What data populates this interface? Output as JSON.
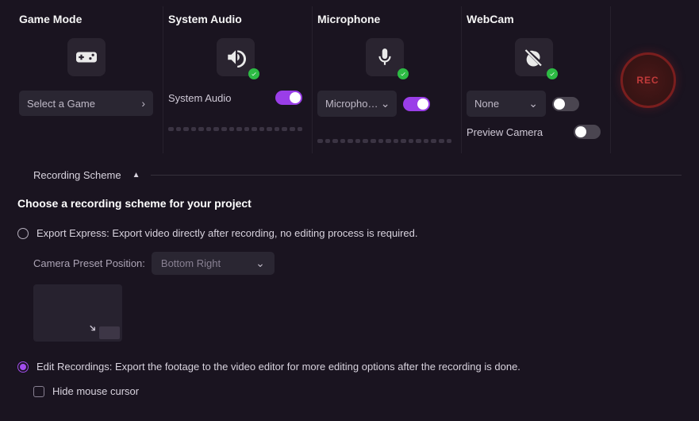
{
  "columns": {
    "gameMode": {
      "title": "Game Mode",
      "selectLabel": "Select a Game"
    },
    "systemAudio": {
      "title": "System Audio",
      "toggleLabel": "System Audio",
      "toggleOn": true
    },
    "microphone": {
      "title": "Microphone",
      "selectLabel": "Microphone A",
      "toggleOn": true
    },
    "webcam": {
      "title": "WebCam",
      "selectLabel": "None",
      "toggleOn": false,
      "previewLabel": "Preview Camera",
      "previewOn": false
    }
  },
  "recButton": "REC",
  "scheme": {
    "header": "Recording Scheme",
    "prompt": "Choose a recording scheme for your project",
    "optionExport": "Export Express: Export video directly after recording, no editing process is required.",
    "cameraPresetLabel": "Camera Preset Position:",
    "cameraPresetValue": "Bottom Right",
    "optionEdit": "Edit Recordings: Export the footage to the video editor for more editing options after the recording is done.",
    "hideMouseLabel": "Hide mouse cursor"
  }
}
